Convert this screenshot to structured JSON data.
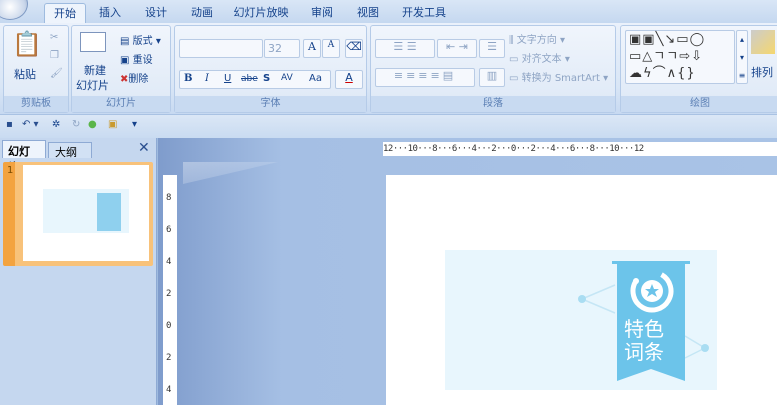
{
  "tabs": [
    "开始",
    "插入",
    "设计",
    "动画",
    "幻灯片放映",
    "审阅",
    "视图",
    "开发工具"
  ],
  "ribbon": {
    "clipboard": {
      "label": "剪贴板",
      "paste": "粘贴"
    },
    "slides": {
      "label": "幻灯片",
      "new_slide_1": "新建",
      "new_slide_2": "幻灯片",
      "layout": "版式",
      "reset": "重设",
      "delete": "删除"
    },
    "font": {
      "label": "字体",
      "font_name": "",
      "font_size": "32",
      "bold": "B",
      "italic": "I",
      "underline": "U",
      "strike": "abe",
      "shadow": "S",
      "spacing": "AV",
      "case": "Aa",
      "color": "A",
      "grow": "A",
      "shrink": "A"
    },
    "paragraph": {
      "label": "段落",
      "text_direction": "文字方向",
      "align_text": "对齐文本",
      "smartart": "转换为 SmartArt"
    },
    "drawing": {
      "label": "绘图",
      "arrange": "排列"
    }
  },
  "qat": {
    "more": "▾"
  },
  "left_pane": {
    "tab_slides": "幻灯片",
    "tab_outline": "大纲",
    "close": "✕",
    "slide_number": "1"
  },
  "rulers": {
    "horizontal": "12···10···8···6···4···2···0···2···4···6···8···10···12",
    "vertical": [
      "8",
      "6",
      "4",
      "2",
      "0",
      "2",
      "4"
    ]
  },
  "slide": {
    "badge_line1": "特色",
    "badge_line2": "词条"
  },
  "colors": {
    "accent": "#6cc4ea",
    "panel": "#e8f6fd",
    "orange": "#f5a443"
  }
}
